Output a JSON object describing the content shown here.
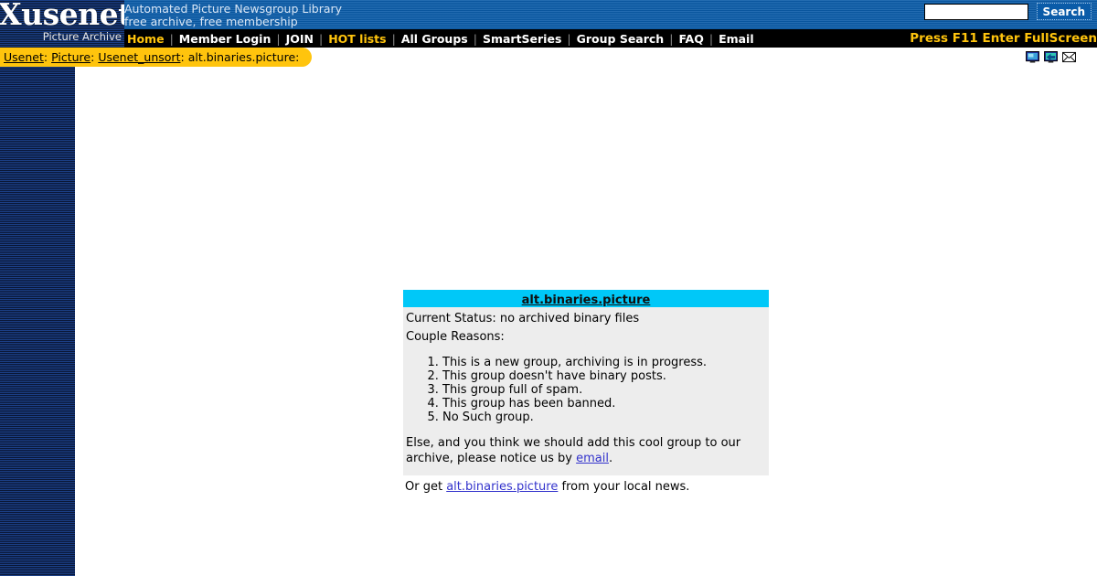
{
  "header": {
    "logo_word": "Xusenet",
    "logo_sub": "Picture Archive",
    "tagline_line1": "Automated Picture Newsgroup Library",
    "tagline_line2": "free archive, free membership",
    "search_value": "",
    "search_placeholder": "",
    "search_button_label": "Search"
  },
  "nav": {
    "items": [
      {
        "label": "Home",
        "hot": true
      },
      {
        "label": "Member Login",
        "hot": false
      },
      {
        "label": "JOIN",
        "hot": false
      },
      {
        "label": "HOT lists",
        "hot": true
      },
      {
        "label": "All Groups",
        "hot": false
      },
      {
        "label": "SmartSeries",
        "hot": false
      },
      {
        "label": "Group Search",
        "hot": false
      },
      {
        "label": "FAQ",
        "hot": false
      },
      {
        "label": "Email",
        "hot": false
      }
    ],
    "separator": "|",
    "fullscreen_note": "Press F11 Enter FullScreen"
  },
  "breadcrumb": {
    "items": [
      {
        "label": "Usenet",
        "link": true
      },
      {
        "label": "Picture",
        "link": true
      },
      {
        "label": "Usenet_unsort",
        "link": true
      },
      {
        "label": "alt.binaries.picture",
        "link": false
      }
    ],
    "separator": ":",
    "trailing": ":"
  },
  "corner_icons": [
    {
      "name": "monitor-icon"
    },
    {
      "name": "monitor-refresh-icon"
    },
    {
      "name": "envelope-icon"
    }
  ],
  "main": {
    "group_name": "alt.binaries.picture",
    "status_line": "Current Status: no archived binary files",
    "reasons_heading": "Couple Reasons:",
    "reasons": [
      "This is a new group, archiving is in progress.",
      "This group doesn't have binary posts.",
      "This group full of spam.",
      "This group has been banned.",
      "No Such group."
    ],
    "else_text_before": "Else, and you think we should add this cool group to our archive, please notice us by ",
    "else_link_label": "email",
    "else_text_after": ".",
    "localnews_before": "Or get ",
    "localnews_link_label": "alt.binaries.picture",
    "localnews_after": " from your local news."
  },
  "colors": {
    "header_blue": "#0a5ba8",
    "nav_black": "#000000",
    "accent_yellow": "#ffc40d",
    "title_cyan": "#00c8f8",
    "panel_gray": "#ededed",
    "link_blue": "#3333cc",
    "sidebar_navy": "#132a55"
  }
}
